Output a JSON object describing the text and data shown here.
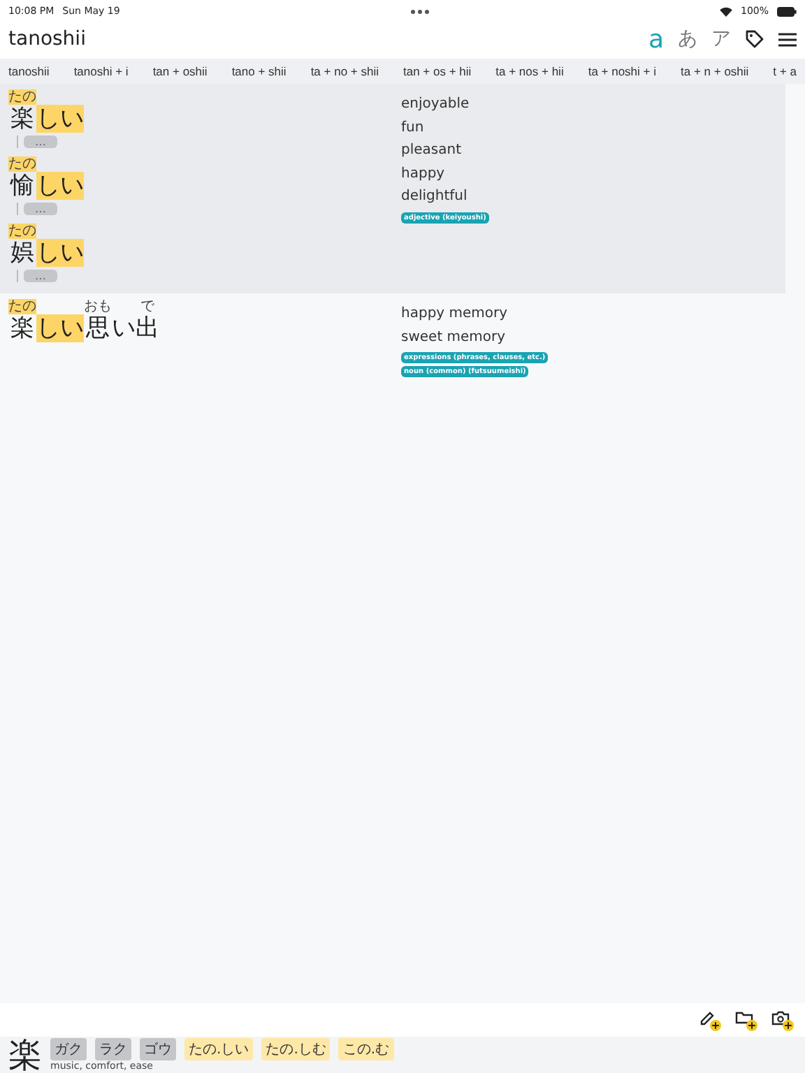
{
  "status_bar": {
    "time": "10:08 PM",
    "date": "Sun May 19",
    "battery": "100%"
  },
  "header": {
    "title": "tanoshii",
    "scripts": [
      {
        "label": "a",
        "selected": true
      },
      {
        "label": "あ",
        "selected": false
      },
      {
        "label": "ア",
        "selected": false
      }
    ]
  },
  "segmentations": [
    "tanoshii",
    "tanoshi + i",
    "tan + oshii",
    "tano + shii",
    "ta + no + shii",
    "tan + os + hii",
    "ta + nos + hii",
    "ta + noshi + i",
    "ta + n + oshii",
    "t + a"
  ],
  "results": [
    {
      "selected": true,
      "words": [
        {
          "segments": [
            {
              "text": "楽",
              "ruby": "たの",
              "highlighted": true
            },
            {
              "text": "しい",
              "highlighted": true
            }
          ],
          "more": "…"
        },
        {
          "segments": [
            {
              "text": "愉",
              "ruby": "たの",
              "highlighted": true
            },
            {
              "text": "しい",
              "highlighted": true
            }
          ],
          "more": "…"
        },
        {
          "segments": [
            {
              "text": "娯",
              "ruby": "たの",
              "highlighted": true
            },
            {
              "text": "しい",
              "highlighted": true
            }
          ],
          "more": "…"
        }
      ],
      "meanings": [
        "enjoyable",
        "fun",
        "pleasant",
        "happy",
        "delightful"
      ],
      "tags": [
        "adjective (keiyoushi)"
      ]
    },
    {
      "selected": false,
      "words": [
        {
          "segments": [
            {
              "text": "楽",
              "ruby": "たの",
              "highlighted": true
            },
            {
              "text": "しい",
              "highlighted": true
            },
            {
              "text": "思",
              "ruby": "おも",
              "highlighted": false
            },
            {
              "text": "い",
              "highlighted": false
            },
            {
              "text": "出",
              "ruby": "で",
              "highlighted": false
            }
          ]
        }
      ],
      "meanings": [
        "happy memory",
        "sweet memory"
      ],
      "tags": [
        "expressions (phrases, clauses, etc.)",
        "noun (common) (futsuumeishi)"
      ]
    }
  ],
  "kanji": {
    "character": "楽",
    "meaning": "music, comfort, ease",
    "readings": [
      {
        "text": "ガク",
        "kind": "on"
      },
      {
        "text": "ラク",
        "kind": "on"
      },
      {
        "text": "ゴウ",
        "kind": "on"
      },
      {
        "text": "たの.しい",
        "kind": "kun"
      },
      {
        "text": "たの.しむ",
        "kind": "kun"
      },
      {
        "text": "この.む",
        "kind": "kun"
      }
    ]
  }
}
